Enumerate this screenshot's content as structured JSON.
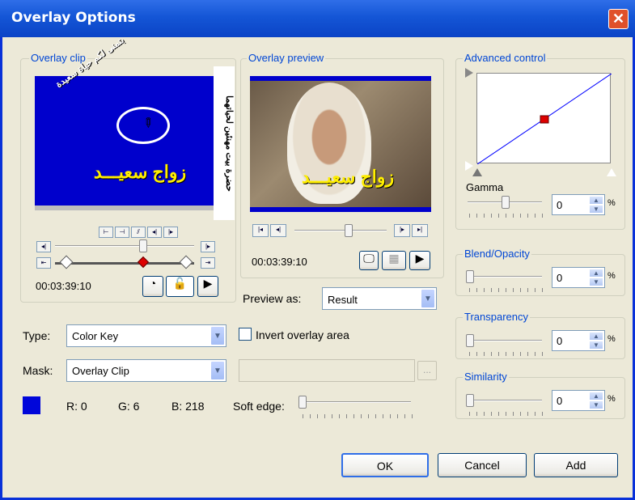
{
  "window": {
    "title": "Overlay Options"
  },
  "overlay_clip": {
    "title": "Overlay clip",
    "arabic_caption": "زواج سعيـــد",
    "arabic_side_text": "بتمنى لكم حياة سعيدة",
    "timecode": "00:03:39:10"
  },
  "overlay_preview": {
    "title": "Overlay preview",
    "arabic_caption": "زواج سعيـــد",
    "timecode": "00:03:39:10",
    "preview_as_label": "Preview as:",
    "preview_as_value": "Result"
  },
  "vertical_watermark": "حضرة بيت مهنئين لحياتهما",
  "advanced": {
    "title": "Advanced control",
    "gamma_label": "Gamma",
    "gamma_value": "0",
    "unit": "%"
  },
  "blend": {
    "title": "Blend/Opacity",
    "value": "0",
    "unit": "%"
  },
  "transparency": {
    "title": "Transparency",
    "value": "0",
    "unit": "%"
  },
  "similarity": {
    "title": "Similarity",
    "value": "0",
    "unit": "%"
  },
  "type": {
    "label": "Type:",
    "value": "Color Key"
  },
  "invert": {
    "label": "Invert overlay area"
  },
  "mask": {
    "label": "Mask:",
    "value": "Overlay Clip",
    "browse": "..."
  },
  "color": {
    "swatch": "#0006da",
    "r": "R: 0",
    "g": "G: 6",
    "b": "B: 218"
  },
  "soft_edge": {
    "label": "Soft edge:"
  },
  "buttons": {
    "ok": "OK",
    "cancel": "Cancel",
    "add": "Add"
  }
}
